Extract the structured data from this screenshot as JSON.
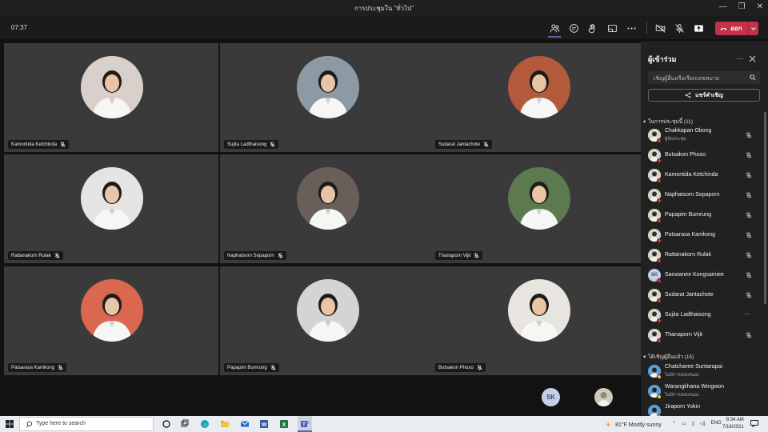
{
  "window": {
    "title": "การประชุมใน \"ทั่วไป\""
  },
  "toolbar": {
    "timer": "07:37",
    "leave_label": "ออก"
  },
  "tiles": [
    {
      "name": "Kamontida Ketchinda",
      "bg": "#d9d0cc"
    },
    {
      "name": "Sujita Ladthaisong",
      "bg": "#8e9aa3"
    },
    {
      "name": "Sudarat Jantachote",
      "bg": "#b25a3b"
    },
    {
      "name": "Rattanakorn Rulak",
      "bg": "#e6e4e2"
    },
    {
      "name": "Naphatsorn Sopaporn",
      "bg": "#6a5e58"
    },
    {
      "name": "Thanaporn Vijit",
      "bg": "#5d7a4f"
    },
    {
      "name": "Patsarasa Kamkong",
      "bg": "#d9684f"
    },
    {
      "name": "Papapim Bumrung",
      "bg": "#d4d4d4"
    },
    {
      "name": "Butsakon Phoso",
      "bg": "#e8e4df"
    }
  ],
  "mini": {
    "initials": "SK"
  },
  "panel": {
    "title": "ผู้เข้าร่วม",
    "search_placeholder": "เชิญผู้อื่นหรือเรียกเลขหมาย",
    "share_label": "แชร์คำเชิญ",
    "in_meeting_label": "ในการประชุมนี้ (11)",
    "invited_label": "ได้เชิญผู้อื่นแล้ว (15)",
    "in_meeting": [
      {
        "name": "Chakkapan Obong",
        "role": "ผู้จัดประชุม"
      },
      {
        "name": "Butsakon Phoso"
      },
      {
        "name": "Kamontida Ketchinda"
      },
      {
        "name": "Naphatsorn Sopaporn"
      },
      {
        "name": "Papapim Bumrung"
      },
      {
        "name": "Patsarasa Kamkong"
      },
      {
        "name": "Rattanakorn Rulak"
      },
      {
        "name": "Saowanee Kongsamiee",
        "initials": "SK"
      },
      {
        "name": "Sudarat Jantachote"
      },
      {
        "name": "Sujita Ladthaisong"
      },
      {
        "name": "Thanaporn Vijit"
      }
    ],
    "invited": [
      {
        "name": "Chatcharee Suntarapai",
        "status": "ไม่มีการตอบสนอง"
      },
      {
        "name": "Warangkhana Wingwon",
        "status": "ไม่มีการตอบสนอง"
      },
      {
        "name": "Jiraporn Yokin"
      }
    ]
  },
  "taskbar": {
    "search_placeholder": "Type here to search",
    "weather": "81°F  Mostly sunny",
    "lang": "ENG",
    "time": "8:34 AM",
    "date": "7/16/2021"
  },
  "colors": {
    "leave": "#c4314b",
    "accent": "#6264a7",
    "muted": "#d13438"
  }
}
